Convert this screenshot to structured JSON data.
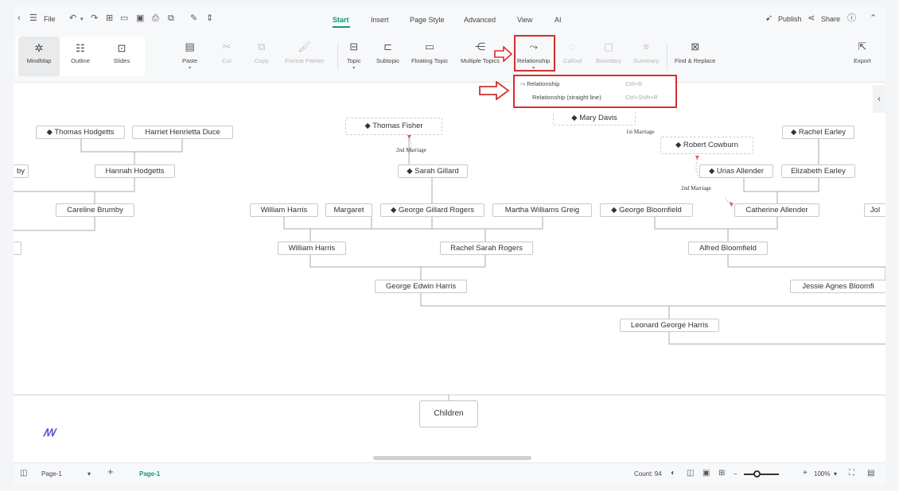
{
  "menubar": {
    "back_icon": "chevron-left-icon",
    "menu_icon": "hamburger-icon",
    "file_label": "File",
    "tabs": [
      {
        "label": "Start",
        "active": true
      },
      {
        "label": "Insert",
        "active": false
      },
      {
        "label": "Page Style",
        "active": false
      },
      {
        "label": "Advanced",
        "active": false
      },
      {
        "label": "View",
        "active": false
      },
      {
        "label": "AI",
        "active": false
      }
    ],
    "publish_label": "Publish",
    "share_label": "Share"
  },
  "ribbon": {
    "views": [
      {
        "label": "MindMap",
        "icon": "mindmap-icon",
        "active": true
      },
      {
        "label": "Outline",
        "icon": "outline-icon",
        "active": false
      },
      {
        "label": "Slides",
        "icon": "slides-icon",
        "active": false
      }
    ],
    "paste": "Paste",
    "cut": "Cut",
    "copy": "Copy",
    "format_painter": "Format Painter",
    "topic": "Topic",
    "subtopic": "Subtopic",
    "floating_topic": "Floating Topic",
    "multiple_topics": "Multiple Topics",
    "relationship": "Relationship",
    "callout": "Callout",
    "boundary": "Boundary",
    "summary": "Summary",
    "find_replace": "Find & Replace",
    "export": "Export"
  },
  "relationship_menu": {
    "items": [
      {
        "label": "Relationship",
        "shortcut": "Ctrl+R"
      },
      {
        "label": "Relationship (straight line)",
        "shortcut": "Ctrl+Shift+R"
      }
    ]
  },
  "tree": {
    "nodes": {
      "thomas_hodgetts": "◆ Thomas Hodgetts",
      "harriet_duce": "Harriet Henrietta Duce",
      "hannah_hodgetts": "Hannah Hodgetts",
      "partial_left": "by",
      "caroline_brumby": "Careline Brumby",
      "thomas_fisher": "◆ Thomas Fisher",
      "mary_davis": "◆ Mary Davis",
      "robert_cowburn": "◆ Robert Cowburn",
      "rachel_earley": "◆ Rachel Earley",
      "sarah_gillard": "◆ Sarah Gillard",
      "urias_allender": "◆ Urias Allender",
      "elizabeth_earley": "Elizabeth Earley",
      "william_harris_sr": "William Harris",
      "margaret": "Margaret",
      "george_gillard_rogers": "◆ George Gillard Rogers",
      "martha_greig": "Martha Williams Greig",
      "george_bloomfield": "◆ George Bloomfield",
      "catherine_allender": "Catherine Allender",
      "partial_right": "Jol",
      "william_harris": "William Harris",
      "rachel_rogers": "Rachel Sarah Rogers",
      "alfred_bloomfield": "Alfred Bloomfield",
      "george_edwin_harris": "George Edwin Harris",
      "jessie_bloomfield": "Jessie Agnes Bloomfi",
      "leonard_harris": "Leonard George Harris"
    },
    "labels": {
      "fisher_marriage": "2nd Marriage",
      "davis_marriage": "1st Marriage",
      "cowburn_marriage": "2nd Marriage"
    },
    "children": "Children"
  },
  "statusbar": {
    "page_select": "Page-1",
    "page_tab": "Page-1",
    "count": "Count: 94",
    "zoom": "100%"
  }
}
